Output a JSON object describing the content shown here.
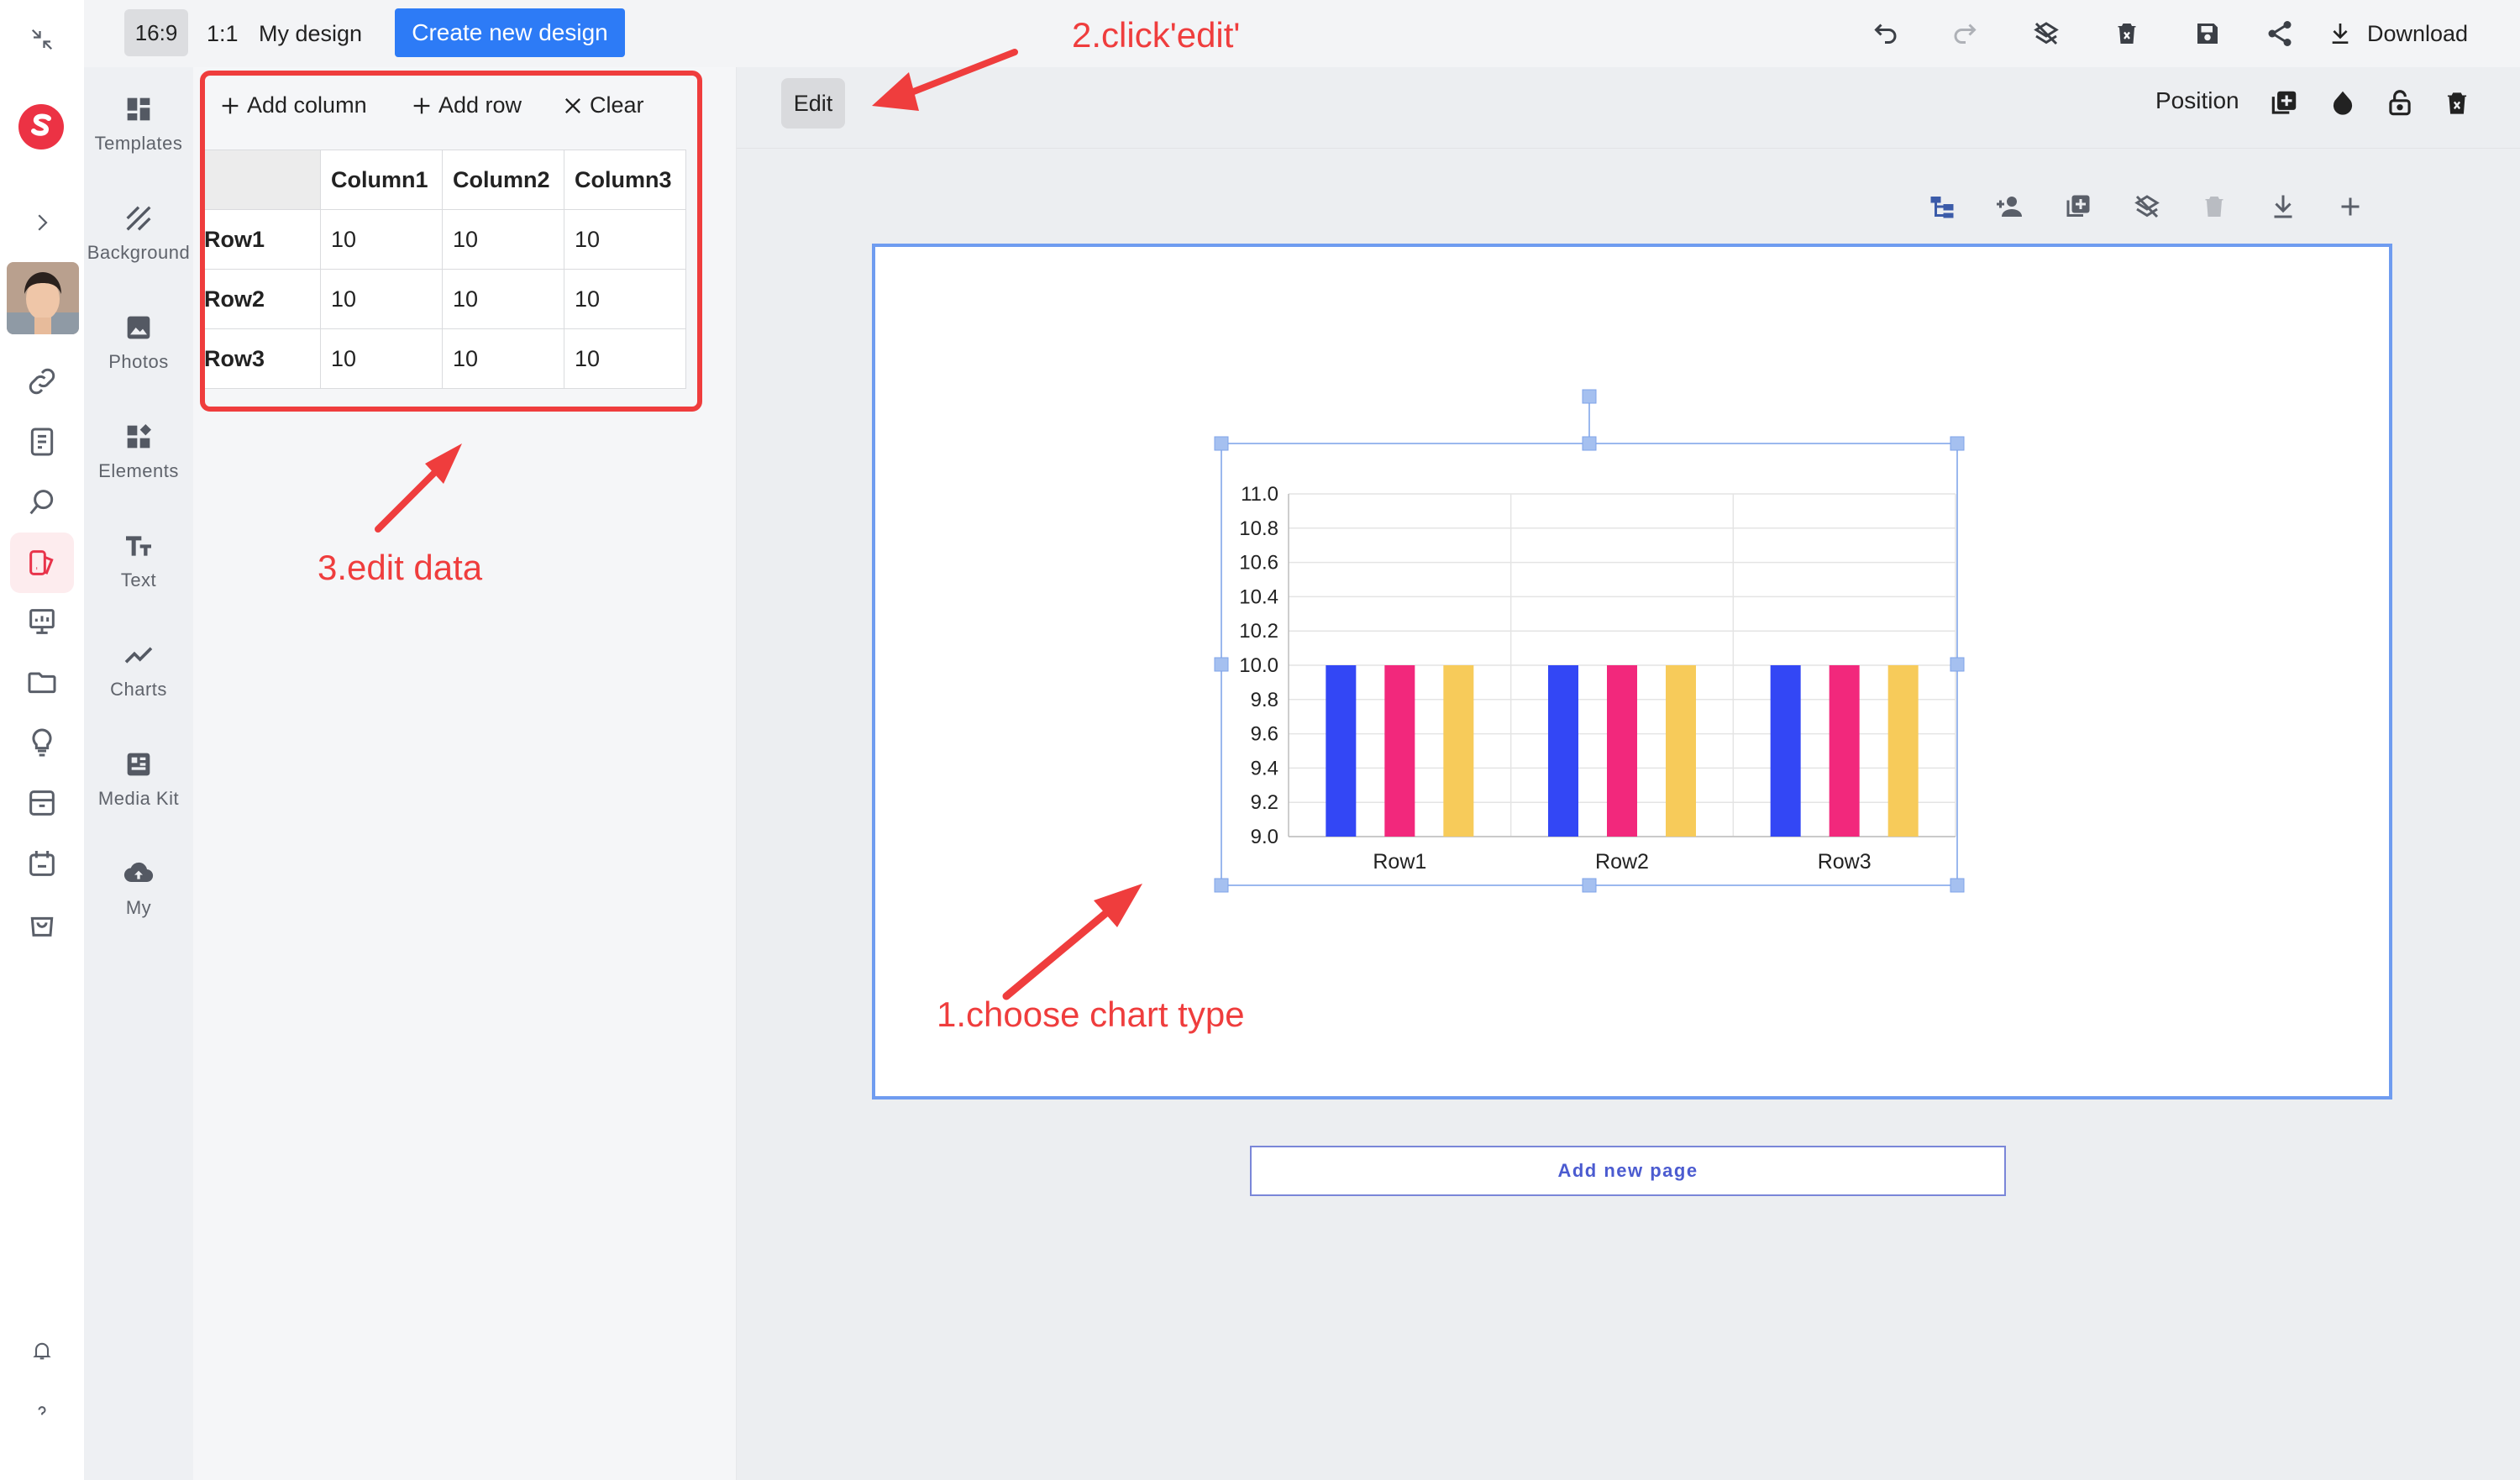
{
  "topbar": {
    "ratio_16_9": "16:9",
    "ratio_1_1": "1:1",
    "design_name": "My design",
    "create_button": "Create new design",
    "download_label": "Download"
  },
  "sidenav": {
    "items": [
      {
        "label": "Templates",
        "icon": "templates-icon"
      },
      {
        "label": "Background",
        "icon": "background-icon"
      },
      {
        "label": "Photos",
        "icon": "photos-icon"
      },
      {
        "label": "Elements",
        "icon": "elements-icon"
      },
      {
        "label": "Text",
        "icon": "text-icon"
      },
      {
        "label": "Charts",
        "icon": "charts-icon"
      },
      {
        "label": "Media Kit",
        "icon": "media-kit-icon"
      },
      {
        "label": "My",
        "icon": "cloud-upload-icon"
      }
    ]
  },
  "panel": {
    "add_column": "Add column",
    "add_row": "Add row",
    "clear": "Clear",
    "table": {
      "columns": [
        "Column1",
        "Column2",
        "Column3"
      ],
      "rows": [
        {
          "label": "Row1",
          "values": [
            "10",
            "10",
            "10"
          ]
        },
        {
          "label": "Row2",
          "values": [
            "10",
            "10",
            "10"
          ]
        },
        {
          "label": "Row3",
          "values": [
            "10",
            "10",
            "10"
          ]
        }
      ]
    }
  },
  "workspace": {
    "edit_button": "Edit",
    "position_label": "Position",
    "add_new_page": "Add new page"
  },
  "annotations": {
    "step1": "1.choose chart type",
    "step2": "2.click'edit'",
    "step3": "3.edit data"
  },
  "chart_data": {
    "type": "bar",
    "categories": [
      "Row1",
      "Row2",
      "Row3"
    ],
    "series": [
      {
        "values": [
          10,
          10,
          10
        ]
      },
      {
        "values": [
          10,
          10,
          10
        ]
      },
      {
        "values": [
          10,
          10,
          10
        ]
      }
    ],
    "colors": [
      "#3347f5",
      "#f2287c",
      "#f7cb5a"
    ],
    "ylim": [
      9.0,
      11.0
    ],
    "yticks": [
      "11.0",
      "10.8",
      "10.6",
      "10.4",
      "10.2",
      "10.0",
      "9.8",
      "9.6",
      "9.4",
      "9.2",
      "9.0"
    ],
    "grid": true
  }
}
